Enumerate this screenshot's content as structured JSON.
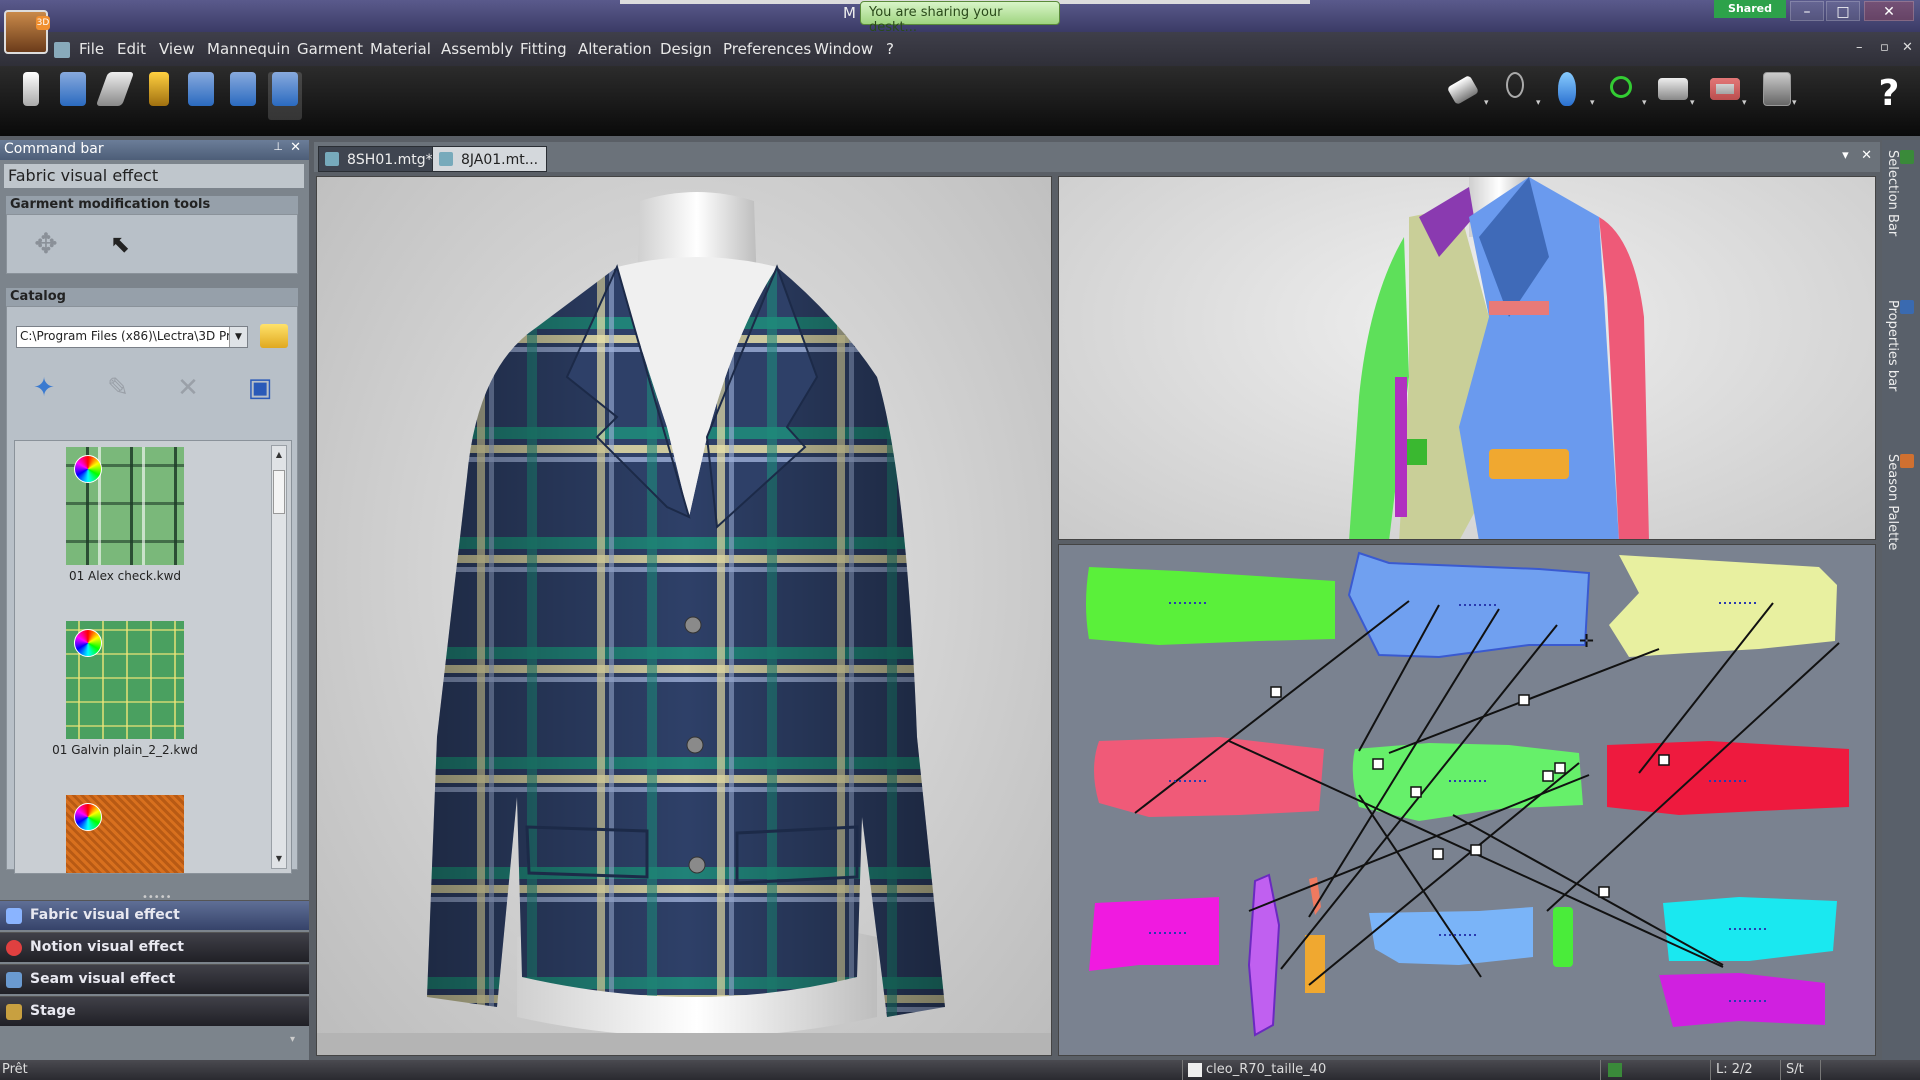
{
  "titlebar": {
    "share_letter": "M",
    "share_notice": "You are sharing your deskt...",
    "shared_badge": "Shared"
  },
  "menu": [
    "File",
    "Edit",
    "View",
    "Mannequin",
    "Garment",
    "Material",
    "Assembly",
    "Fitting",
    "Alteration",
    "Design",
    "Preferences",
    "Window",
    "?"
  ],
  "command_bar": {
    "title": "Command bar",
    "panel_title": "Fabric visual effect",
    "garment_tools_label": "Garment modification tools",
    "catalog_label": "Catalog",
    "catalog_path": "C:\\Program Files (x86)\\Lectra\\3D Pr",
    "swatches": [
      {
        "label": "01 Alex check.kwd",
        "color": "#7ab87a"
      },
      {
        "label": "01 Galvin plain_2_2.kwd",
        "color": "#4aa060"
      },
      {
        "label": "",
        "color": "#d8701e"
      }
    ]
  },
  "nav": [
    {
      "label": "Fabric visual effect",
      "active": true,
      "color": "#8ab4ff"
    },
    {
      "label": "Notion visual effect",
      "active": false,
      "color": "#e04040"
    },
    {
      "label": "Seam visual effect",
      "active": false,
      "color": "#6a9ad0"
    },
    {
      "label": "Stage",
      "active": false,
      "color": "#c8a040"
    }
  ],
  "tabs": [
    {
      "label": "8SH01.mtg*",
      "active": false
    },
    {
      "label": "8JA01.mt...",
      "active": true
    }
  ],
  "right_bar": [
    {
      "label": "Selection Bar",
      "color": "#3a8a3a"
    },
    {
      "label": "Properties bar",
      "color": "#3a6ab0"
    },
    {
      "label": "Season Palette",
      "color": "#d07030"
    }
  ],
  "status": {
    "left": "Prêt",
    "file": "cleo_R70_taille_40",
    "page": "L: 2/2",
    "unit": "S/t"
  },
  "colors": {
    "jacket_navy": "#2e4068",
    "plaid_green": "#1e8a7a",
    "plaid_cream": "#e8e0a8"
  }
}
